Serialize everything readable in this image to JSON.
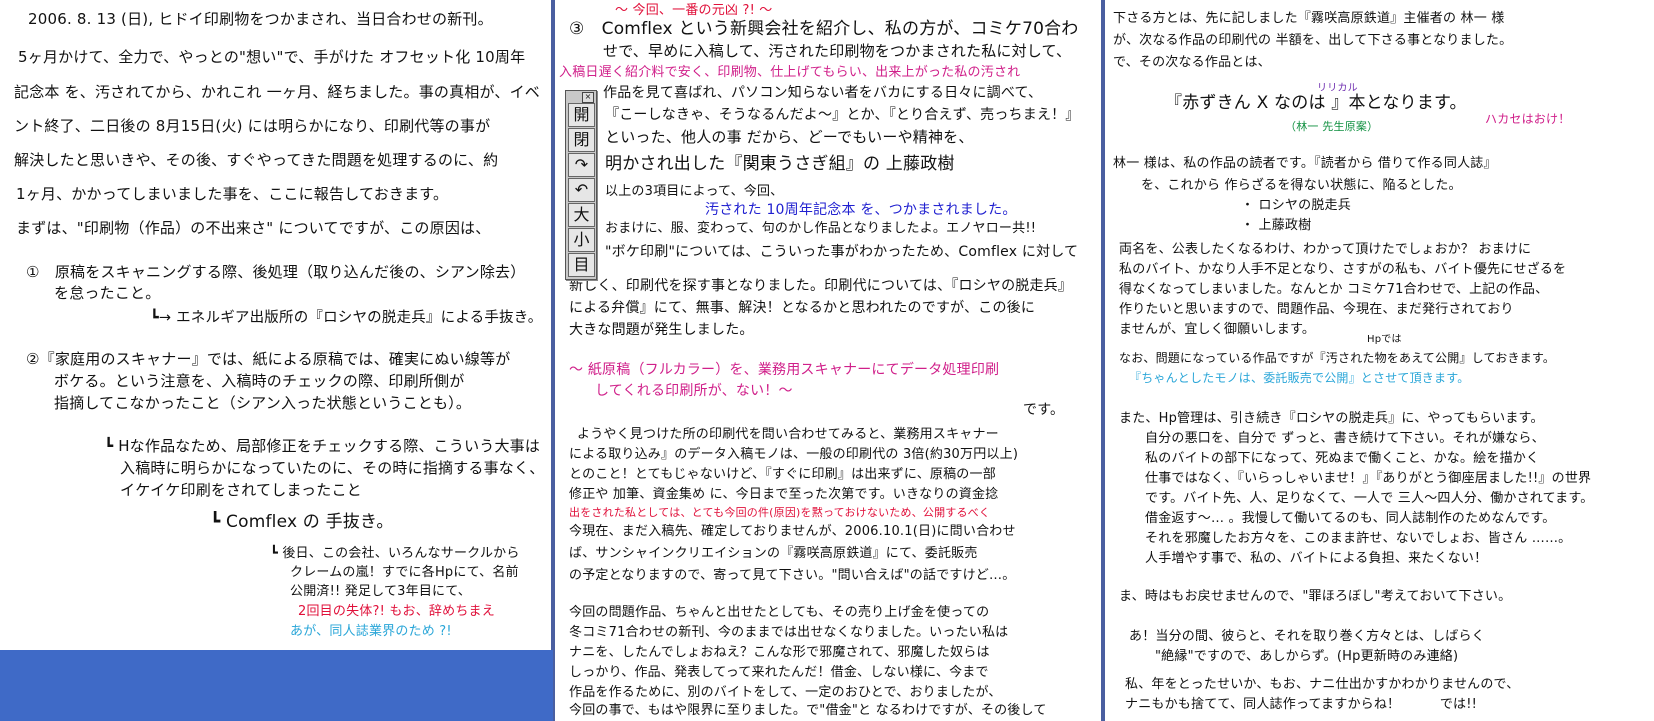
{
  "page1": {
    "lines": [
      "2006. 8. 13 (日), ヒドイ印刷物をつかまされ、当日合わせの新刊。",
      "5ヶ月かけて、全力で、やっとの\"想い\"で、手がけた オフセット化 10周年",
      "記念本 を、汚されてから、かれこれ 一ヶ月、経ちました。事の真相が、イベ",
      "ント終了、二日後の 8月15日(火) には明らかになり、印刷代等の事が",
      "解決したと思いきや、その後、すぐやってきた問題を処理するのに、約",
      "1ヶ月、かかってしまいました事を、ここに報告しておきます。",
      "まずは、\"印刷物（作品）の不出来さ\" についてですが、この原因は、",
      "①　原稿をスキャニングする際、後処理（取り込んだ後の、シアン除去）",
      "を怠ったこと。",
      "┗→ エネルギア出版所の『ロシヤの脱走兵』による手抜き。",
      "②『家庭用のスキャナー』では、紙による原稿では、確実にぬい線等が",
      "ボケる。という注意を、入稿時のチェックの際、印刷所側が",
      "指摘してこなかったこと（シアン入った状態ということも）。",
      "┗ Hな作品なため、局部修正をチェックする際、こういう大事は",
      "入稿時に明らかになっていたのに、その時に指摘する事なく、",
      "イケイケ印刷をされてしまったこと",
      "┗ Comflex の 手抜き。",
      "┗ 後日、この会社、いろんなサークルから",
      "クレームの嵐！すでに各Hpにて、名前",
      "公開済!! 発足して3年目にて、",
      "2回目の失体?! もお、辞めちまえ",
      "あが、同人誌業界のため ?!"
    ]
  },
  "page2": {
    "header_note": "〜 今回、一番の元凶 ?! 〜",
    "lines": [
      "③　Comflex という新興会社を紹介し、私の方が、コミケ70合わ",
      "せで、早めに入稿して、汚された印刷物をつかまされた私に対して、",
      "入稿日遅く紹介料で安く、印刷物、仕上げてもらい、出来上がった私の汚され",
      "作品を見て喜ばれ、パソコン知らない者をバカにする日々に調べて、",
      "『こーしなきゃ、そうなるんだよ〜』とか、『とり合えず、売っちまえ！』",
      "といった、他人の事 だから、どーでもいーや精神を、",
      "明かされ出した『関東うさぎ組』の 上藤政樹",
      "以上の3項目によって、今回、",
      "汚された 10周年記念本 を、つかまされました。",
      "おまけに、服、変わって、句のかし作品となりましたよ。エノヤロー共!!",
      "\"ボケ印刷\"については、こういった事がわかったため、Comflex に対して",
      "新しく、印刷代を探す事となりました。印刷代については、『ロシヤの脱走兵』",
      "による弁償』にて、無事、解決！となるかと思われたのですが、この後に",
      "大きな問題が発生しました。",
      "〜 紙原稿（フルカラー）を、業務用スキャナーにてデータ処理印刷",
      "してくれる印刷所が、ない！〜",
      "です。",
      "ようやく見つけた所の印刷代を問い合わせてみると、業務用スキャナー",
      "による取り込み』のデータ入稿モノは、一般の印刷代の 3倍(約30万円以上)",
      "とのこと！とてもじゃないけど、『すぐに印刷』は出来ずに、原稿の一部",
      "修正や 加筆、資金集め に、今日まで至った次第です。いきなりの資金捻",
      "出をされた私としては、とても今回の件(原因)を黙っておけないため、公開するべく",
      "今現在、まだ入稿先、確定しておりませんが、2006.10.1(日)に問い合わせ",
      "ば、サンシャインクリエイションの『霧咲高原鉄道』にて、委託販売",
      "の予定となりますので、寄って見て下さい。\"問い合えば\"の話ですけど…。",
      "今回の問題作品、ちゃんと出せたとしても、その売り上げ金を使っての",
      "冬コミ71合わせの新刊、今のままでは出せなくなりました。いったい私は",
      "ナニを、したんでしょおねえ？こんな形で邪魔されて、邪魔した奴らは",
      "しっかり、作品、発表してって来れたんだ！借金、しない様に、今まで",
      "作品を作るために、別のバイトをして、一定のおひとで、おりましたが、",
      "今回の事で、もはや限界に至りました。で\"借金\"と なるわけですが、その後して"
    ]
  },
  "page3": {
    "lines": [
      "下さる方とは、先に記しました『霧咲高原鉄道』主催者の 林一 様",
      "が、次なる作品の印刷代の 半額を、出して下さる事となりました。",
      "で、その次なる作品とは、",
      "リリカル",
      "『赤ずきん X なのは 』本となります。",
      "（林一 先生原案）",
      "ハカセはおけ！",
      "林一 様は、私の作品の読者です。『読者から 借りて作る同人誌』",
      "を、これから 作らざるを得ない状態に、陥るとした。",
      "・ ロシヤの脱走兵",
      "・ 上藤政樹",
      "両名を、公表したくなるわけ、わかって頂けたでしょおか？ おまけに",
      "私のバイト、かなり人手不足となり、さすがの私も、バイト優先にせざるを",
      "得なくなってしまいました。なんとか コミケ71合わせで、上記の作品、",
      "作りたいと思いますので、問題作品、今現在、まだ発行されており",
      "ませんが、宜しく御願いします。",
      "Hpでは",
      "なお、問題になっている作品ですが『汚された物をあえて公開』しておきます。",
      "『ちゃんとしたモノは、委託販売で公開』とさせて頂きます。",
      "また、Hp管理は、引き続き『ロシヤの脱走兵』に、やってもらいます。",
      "自分の悪口を、自分で ずっと、書き続けて下さい。それが嫌なら、",
      "私のバイトの部下になって、死ぬまで働くこと、かな。絵を描かく",
      "仕事ではなく、『いらっしゃいませ！』『ありがとう御座居ました!!』の世界",
      "です。バイト先、人、足りなくて、一人で 三人〜四人分、働かされてます。",
      "借金返す〜… 。我慢して働いてるのも、同人誌制作のためなんです。",
      "それを邪魔したお方々を、このまま許せ、ないでしょお、皆さん ……。",
      "人手増やす事で、私の、バイトによる負担、来たくない！",
      "ま、時はもお戻せませんので、\"罪ほろぼし\"考えておいて下さい。",
      "あ！当分の間、彼らと、それを取り巻く方々とは、しばらく",
      "\"絶縁\"ですので、あしからず。(Hp更新時のみ連絡)",
      "私、年をとったせいか、もお、ナニ仕出かすかわかりませんので、",
      "ナニもかも捨てて、同人誌作ってますからね！　　　では!!"
    ]
  },
  "toolbar": {
    "close": "×",
    "buttons": [
      "開",
      "閉",
      "↷",
      "↶",
      "大",
      "小",
      "目"
    ]
  }
}
